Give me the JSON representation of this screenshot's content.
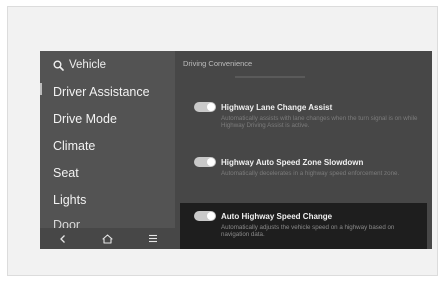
{
  "sidebar": {
    "header": "Vehicle",
    "items": [
      {
        "label": "Driver Assistance"
      },
      {
        "label": "Drive Mode"
      },
      {
        "label": "Climate"
      },
      {
        "label": "Seat"
      },
      {
        "label": "Lights"
      },
      {
        "label": "Door"
      }
    ]
  },
  "content": {
    "section_title": "Driving Convenience",
    "settings": [
      {
        "title": "Highway Lane Change Assist",
        "description": "Automatically assists with lane changes when the turn signal is on while Highway Driving Assist is active.",
        "enabled": true
      },
      {
        "title": "Highway Auto Speed Zone Slowdown",
        "description": "Automatically decelerates in a highway speed enforcement zone.",
        "enabled": true
      },
      {
        "title": "Auto Highway Speed Change",
        "description": "Automatically adjusts the vehicle speed on a highway based on navigation data.",
        "enabled": true
      }
    ]
  },
  "icons": {
    "search": "search-icon",
    "back": "back-icon",
    "home": "home-icon",
    "menu": "menu-icon"
  }
}
